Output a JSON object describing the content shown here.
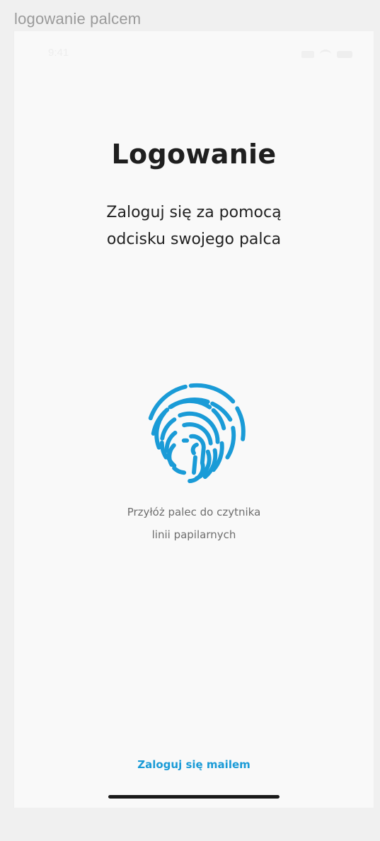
{
  "frame_caption": "logowanie palcem",
  "status_bar": {
    "time": "9:41"
  },
  "login": {
    "title": "Logowanie",
    "subtitle_line1": "Zaloguj się za pomocą",
    "subtitle_line2": "odcisku swojego palca",
    "hint_line1": "Przyłóż palec do czytnika",
    "hint_line2": "linii papilarnych",
    "email_link": "Zaloguj się mailem"
  },
  "icons": {
    "fingerprint": "fingerprint-icon"
  },
  "colors": {
    "accent": "#1a9bd7",
    "screen_background": "#f9f9f9",
    "title_text": "#1f1f1f",
    "hint_text": "#6e6e6e"
  }
}
